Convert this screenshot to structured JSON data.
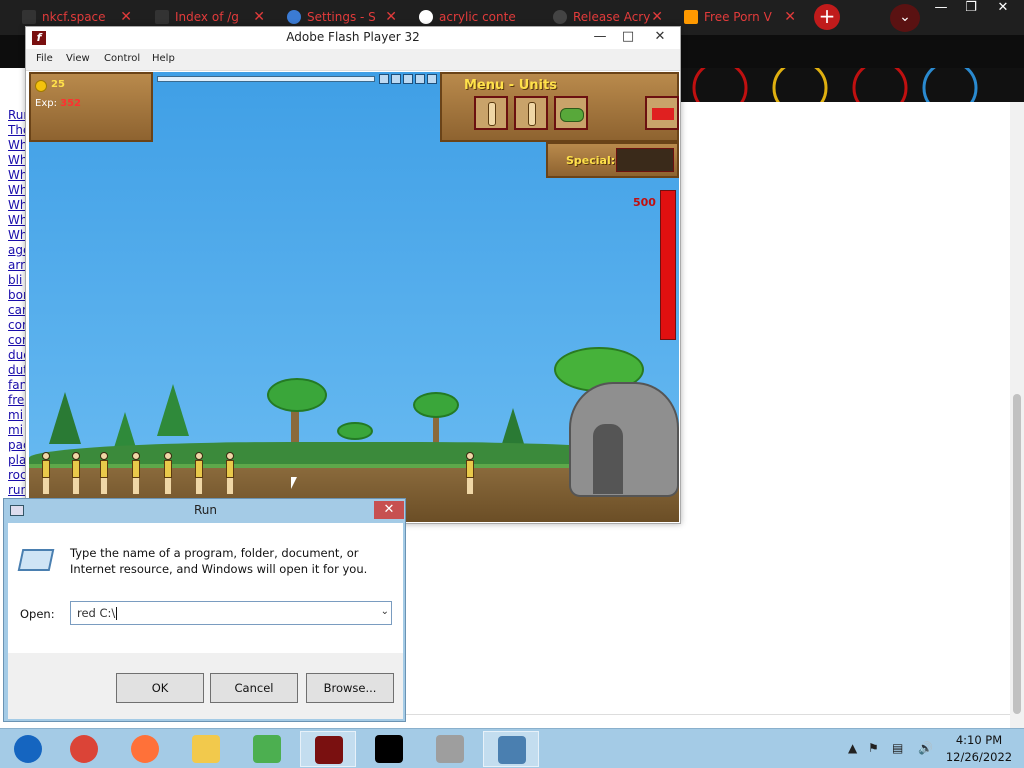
{
  "browser": {
    "tabs": [
      {
        "title": "nkcf.space",
        "color": "#e23b3b"
      },
      {
        "title": "Index of /g",
        "color": "#e23b3b"
      },
      {
        "title": "Settings - S",
        "color": "#e23b3b"
      },
      {
        "title": "acrylic conte",
        "color": "#e23b3b"
      },
      {
        "title": "Release Acry",
        "color": "#e23b3b"
      },
      {
        "title": "Free Porn V",
        "color": "#e23b3b"
      }
    ],
    "new_tab": "+",
    "close_glyph": "✕"
  },
  "page": {
    "links": [
      "Run",
      "The",
      "Wha",
      "Wha",
      "Wha",
      "Wha",
      "Wha",
      "Wha",
      "Wha",
      "age",
      "arr",
      "bli",
      "bor",
      "car",
      "cor",
      "cor",
      "dud",
      "dut",
      "fan",
      "fre",
      "mi",
      "mi",
      "pac",
      "pla",
      "roc",
      "run"
    ]
  },
  "flash_window": {
    "title": "Adobe Flash Player 32",
    "menu": [
      "File",
      "View",
      "Control",
      "Help"
    ],
    "game": {
      "gold": "25",
      "exp_label": "Exp:",
      "exp_value": "352",
      "menu_title": "Menu - Units",
      "special_label": "Special:",
      "base_hp": "500",
      "queue_slots": 5
    }
  },
  "run_dialog": {
    "title": "Run",
    "description": "Type the name of a program, folder, document, or Internet resource, and Windows will open it for you.",
    "open_label": "Open:",
    "input_value": "red C:\\",
    "buttons": {
      "ok": "OK",
      "cancel": "Cancel",
      "browse": "Browse..."
    }
  },
  "taskbar": {
    "apps": [
      {
        "name": "windows-start",
        "color": "#1565c0"
      },
      {
        "name": "chrome",
        "color": "#db4437"
      },
      {
        "name": "firefox",
        "color": "#ff7139"
      },
      {
        "name": "file-explorer",
        "color": "#f2c94c"
      },
      {
        "name": "network-app",
        "color": "#4caf50"
      },
      {
        "name": "flash-player",
        "color": "#7a1010"
      },
      {
        "name": "7zip",
        "color": "#000000"
      },
      {
        "name": "printer",
        "color": "#9e9e9e"
      },
      {
        "name": "run-dialog",
        "color": "#4a7fb0"
      }
    ],
    "clock_time": "4:10 PM",
    "clock_date": "12/26/2022"
  }
}
